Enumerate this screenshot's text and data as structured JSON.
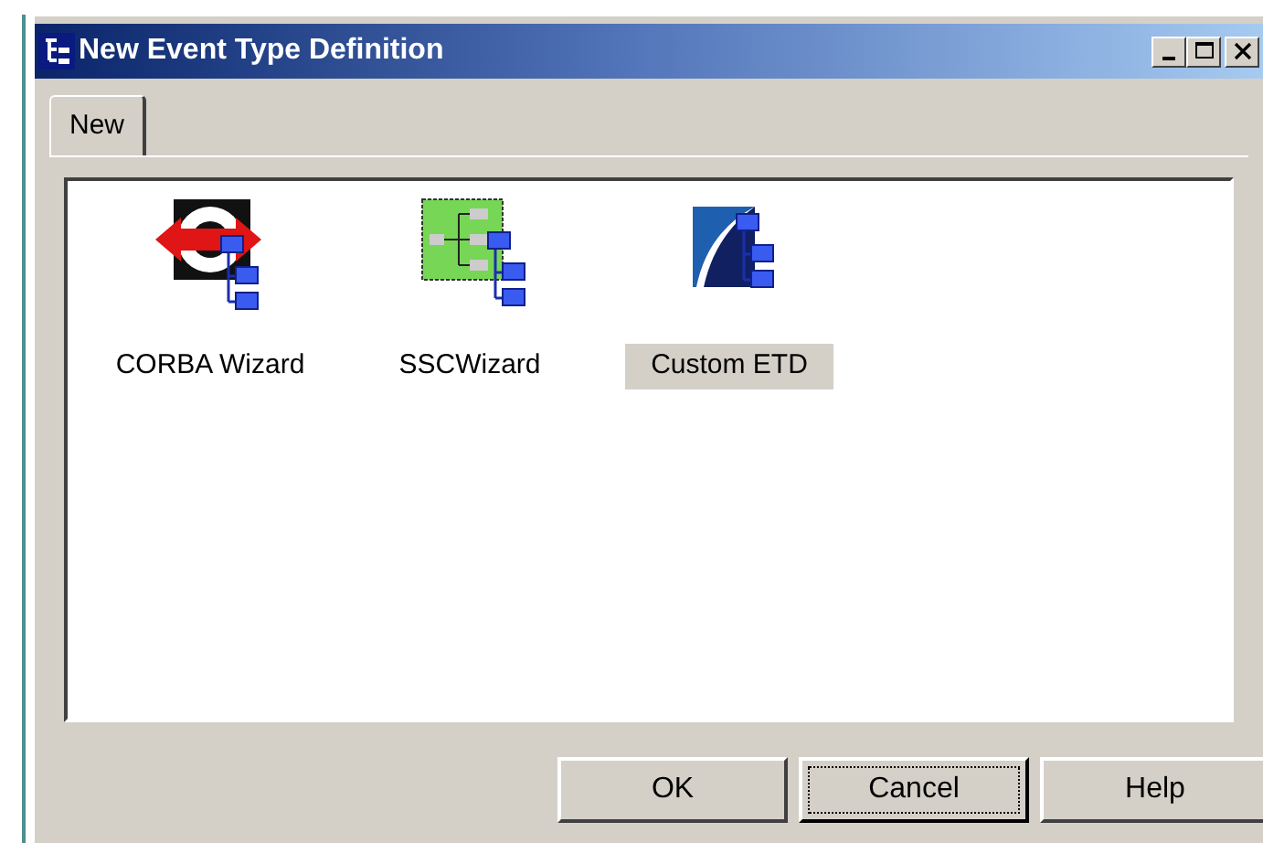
{
  "window": {
    "title": "New Event Type Definition"
  },
  "tabs": [
    {
      "label": "New",
      "selected": true
    }
  ],
  "items": [
    {
      "kind": "corba",
      "label": "CORBA Wizard",
      "selected": false
    },
    {
      "kind": "ssc",
      "label": "SSCWizard",
      "selected": false
    },
    {
      "kind": "custom",
      "label": "Custom ETD",
      "selected": true
    }
  ],
  "buttons": [
    {
      "label": "OK",
      "default": false
    },
    {
      "label": "Cancel",
      "default": true
    },
    {
      "label": "Help",
      "default": false
    }
  ],
  "title_buttons": [
    {
      "kind": "minimize"
    },
    {
      "kind": "maximize"
    },
    {
      "kind": "close"
    }
  ]
}
